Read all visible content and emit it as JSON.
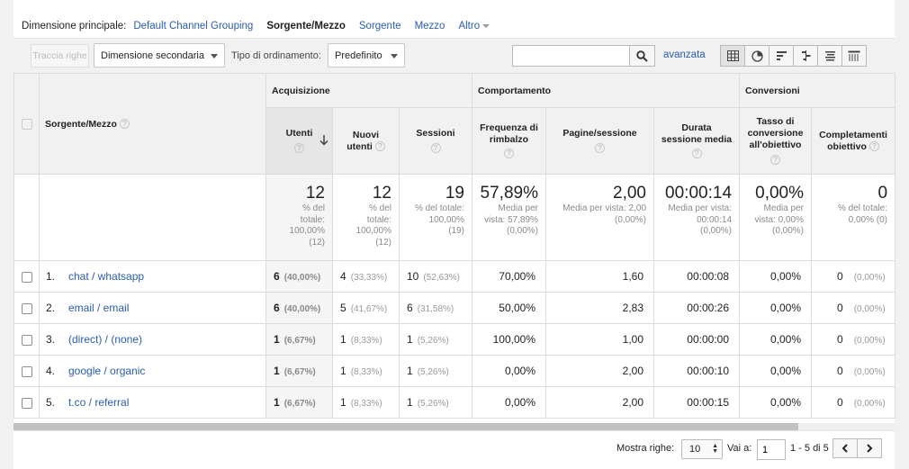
{
  "dimension_bar": {
    "label": "Dimensione principale:",
    "default_channel": "Default Channel Grouping",
    "selected": "Sorgente/Mezzo",
    "source": "Sorgente",
    "medium": "Mezzo",
    "other": "Altro"
  },
  "toolbar": {
    "plot_rows": "Traccia righe",
    "secondary_dimension": "Dimensione secondaria",
    "sort_type_label": "Tipo di ordinamento:",
    "sort_type_value": "Predefinito",
    "search_placeholder": "",
    "advanced": "avanzata",
    "views": [
      "table-view-icon",
      "pie-view-icon",
      "performance-view-icon",
      "comparison-view-icon",
      "term-cloud-view-icon",
      "pivot-view-icon"
    ]
  },
  "table": {
    "groups": {
      "acquisition": "Acquisizione",
      "behavior": "Comportamento",
      "conversions": "Conversioni"
    },
    "dim_header": "Sorgente/Mezzo",
    "columns": {
      "users": "Utenti",
      "new_users_a": "Nuovi",
      "new_users_b": "utenti",
      "sessions": "Sessioni",
      "bounce_a": "Frequenza di",
      "bounce_b": "rimbalzo",
      "pages": "Pagine/sessione",
      "duration_a": "Durata",
      "duration_b": "sessione media",
      "conv_rate_a": "Tasso di",
      "conv_rate_b": "conversione",
      "conv_rate_c": "all'obiettivo",
      "completions_a": "Completamenti",
      "completions_b": "obiettivo"
    },
    "totals": {
      "users": {
        "value": "12",
        "l1": "% del",
        "l2": "totale:",
        "l3": "100,00%",
        "l4": "(12)"
      },
      "new_users": {
        "value": "12",
        "l1": "% del",
        "l2": "totale:",
        "l3": "100,00%",
        "l4": "(12)"
      },
      "sessions": {
        "value": "19",
        "l1": "% del totale:",
        "l2": "100,00%",
        "l3": "(19)"
      },
      "bounce": {
        "value": "57,89%",
        "l1": "Media per",
        "l2": "vista: 57,89%",
        "l3": "(0,00%)"
      },
      "pages": {
        "value": "2,00",
        "l1": "Media per vista: 2,00",
        "l2": "(0,00%)"
      },
      "duration": {
        "value": "00:00:14",
        "l1": "Media per vista:",
        "l2": "00:00:14",
        "l3": "(0,00%)"
      },
      "conv_rate": {
        "value": "0,00%",
        "l1": "Media per",
        "l2": "vista: 0,00%",
        "l3": "(0,00%)"
      },
      "completions": {
        "value": "0",
        "l1": "% del totale:",
        "l2": "0,00% (0)"
      }
    },
    "rows": [
      {
        "idx": "1.",
        "dim": "chat / whatsapp",
        "users": "6",
        "users_pct": "(40,00%)",
        "new_users": "4",
        "new_users_pct": "(33,33%)",
        "sessions": "10",
        "sessions_pct": "(52,63%)",
        "bounce": "70,00%",
        "pages": "1,60",
        "duration": "00:00:08",
        "conv_rate": "0,00%",
        "completions": "0",
        "completions_pct": "(0,00%)"
      },
      {
        "idx": "2.",
        "dim": "email / email",
        "users": "6",
        "users_pct": "(40,00%)",
        "new_users": "5",
        "new_users_pct": "(41,67%)",
        "sessions": "6",
        "sessions_pct": "(31,58%)",
        "bounce": "50,00%",
        "pages": "2,83",
        "duration": "00:00:26",
        "conv_rate": "0,00%",
        "completions": "0",
        "completions_pct": "(0,00%)"
      },
      {
        "idx": "3.",
        "dim": "(direct) / (none)",
        "users": "1",
        "users_pct": "(6,67%)",
        "new_users": "1",
        "new_users_pct": "(8,33%)",
        "sessions": "1",
        "sessions_pct": "(5,26%)",
        "bounce": "100,00%",
        "pages": "1,00",
        "duration": "00:00:00",
        "conv_rate": "0,00%",
        "completions": "0",
        "completions_pct": "(0,00%)"
      },
      {
        "idx": "4.",
        "dim": "google / organic",
        "users": "1",
        "users_pct": "(6,67%)",
        "new_users": "1",
        "new_users_pct": "(8,33%)",
        "sessions": "1",
        "sessions_pct": "(5,26%)",
        "bounce": "0,00%",
        "pages": "2,00",
        "duration": "00:00:10",
        "conv_rate": "0,00%",
        "completions": "0",
        "completions_pct": "(0,00%)"
      },
      {
        "idx": "5.",
        "dim": "t.co / referral",
        "users": "1",
        "users_pct": "(6,67%)",
        "new_users": "1",
        "new_users_pct": "(8,33%)",
        "sessions": "1",
        "sessions_pct": "(5,26%)",
        "bounce": "0,00%",
        "pages": "2,00",
        "duration": "00:00:15",
        "conv_rate": "0,00%",
        "completions": "0",
        "completions_pct": "(0,00%)"
      }
    ]
  },
  "pagination": {
    "show_rows_label": "Mostra righe:",
    "show_rows_value": "10",
    "goto_label": "Vai a:",
    "goto_value": "1",
    "range": "1 - 5 di 5"
  },
  "colors": {
    "link": "#2a5db0",
    "header_bg": "#f1f1f1",
    "sorted_col_bg": "#f5f5f5"
  }
}
